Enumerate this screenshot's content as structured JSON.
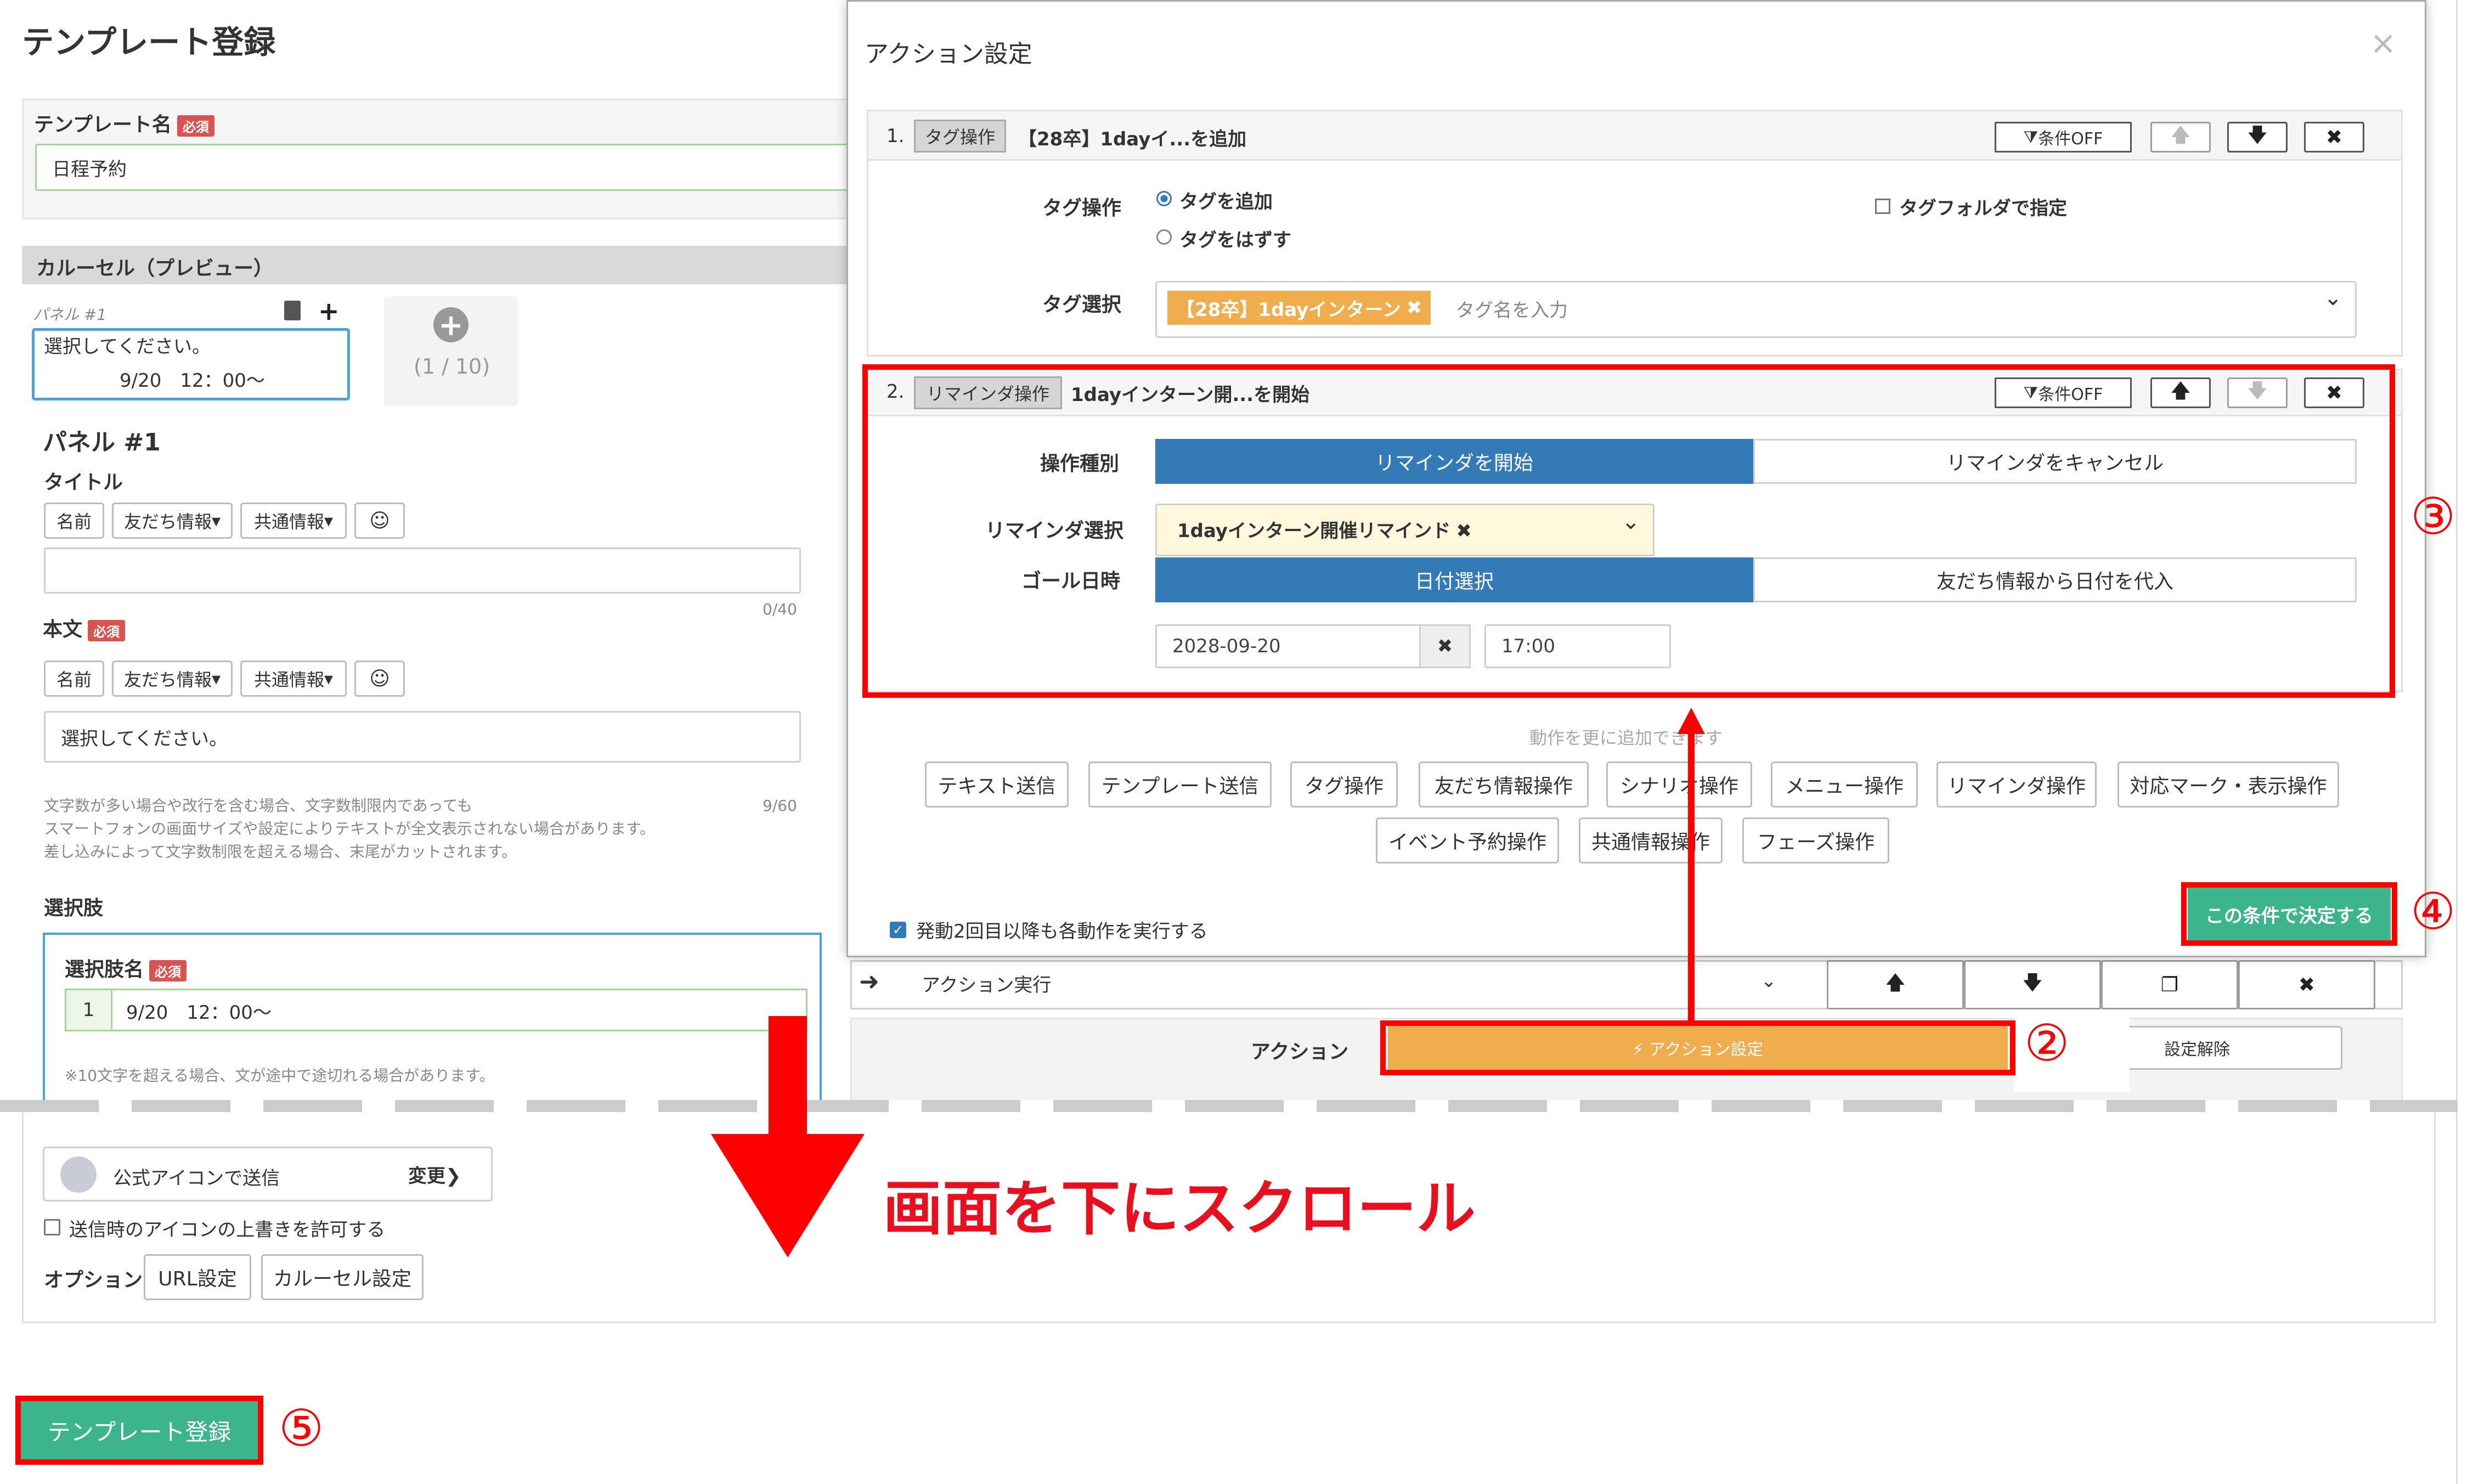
{
  "page": {
    "title": "テンプレート登録",
    "template_name_label": "テンプレート名",
    "required": "必須",
    "template_name_value": "日程予約",
    "carousel_header": "カルーセル（プレビュー）",
    "panel_small": "パネル #1",
    "panel_preview_line1": "選択してください。",
    "panel_preview_line2": "9/20　12：00〜",
    "panel_count": "(1 / 10)",
    "panel_heading": "パネル #1",
    "title_label": "タイトル",
    "btn_name": "名前",
    "btn_friend": "友だち情報",
    "btn_common": "共通情報",
    "title_counter": "0/40",
    "body_label": "本文",
    "body_value": "選択してください。",
    "body_counter": "9/60",
    "note1": "文字数が多い場合や改行を含む場合、文字数制限内であっても",
    "note2": "スマートフォンの画面サイズや設定によりテキストが全文表示されない場合があります。",
    "note3": "差し込みによって文字数制限を超える場合、末尾がカットされます。",
    "choices_label": "選択肢",
    "choice_name_label": "選択肢名",
    "choice_index": "1",
    "choice_value": "9/20　12：00〜",
    "choice_note": "※10文字を超える場合、文が途中で途切れる場合があります。",
    "action_run": "アクション実行",
    "action_label": "アクション",
    "action_setting_btn": "⚡ アクション設定",
    "setting_release": "設定解除",
    "send_icon": "公式アイコンで送信",
    "change": "変更",
    "allow_override": "送信時のアイコンの上書きを許可する",
    "option_label": "オプション",
    "url_setting": "URL設定",
    "carousel_setting": "カルーセル設定",
    "register_btn": "テンプレート登録",
    "scroll_text": "画面を下にスクロール"
  },
  "modal": {
    "title": "アクション設定",
    "close": "×",
    "a1_index": "1.",
    "a1_tag": "タグ操作",
    "a1_title": "【28卒】1dayイ...を追加",
    "cond_off": "条件OFF",
    "tag_op_label": "タグ操作",
    "tag_add": "タグを追加",
    "tag_remove": "タグをはずす",
    "tag_folder": "タグフォルダで指定",
    "tag_select_label": "タグ選択",
    "tag_chip": "【28卒】1dayインターン",
    "tag_placeholder": "タグ名を入力",
    "a2_index": "2.",
    "a2_tag": "リマインダ操作",
    "a2_title": "1dayインターン開...を開始",
    "op_type_label": "操作種別",
    "reminder_start": "リマインダを開始",
    "reminder_cancel": "リマインダをキャンセル",
    "reminder_select_label": "リマインダ選択",
    "reminder_value": "1dayインターン開催リマインド",
    "goal_label": "ゴール日時",
    "date_select": "日付選択",
    "date_from_friend": "友だち情報から日付を代入",
    "date_value": "2028-09-20",
    "time_value": "17:00",
    "add_more": "動作を更に追加できます",
    "add_buttons_row1": [
      "テキスト送信",
      "テンプレート送信",
      "タグ操作",
      "友だち情報操作",
      "シナリオ操作",
      "メニュー操作",
      "リマインダ操作",
      "対応マーク・表示操作"
    ],
    "add_buttons_row2": [
      "イベント予約操作",
      "共通情報操作",
      "フェーズ操作"
    ],
    "repeat_check": "発動2回目以降も各動作を実行する",
    "confirm_btn": "この条件で決定する"
  },
  "annotations": {
    "n2": "②",
    "n3": "③",
    "n4": "④",
    "n5": "⑤"
  },
  "colors": {
    "blue": "#337ab7",
    "orange": "#f0ad4e",
    "green": "#3cb48c",
    "red": "#ff0000",
    "required_red": "#d9534f"
  }
}
